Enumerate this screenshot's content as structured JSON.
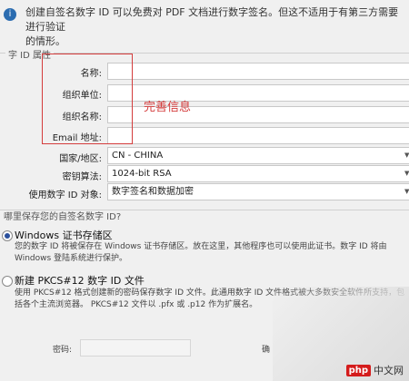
{
  "intro": {
    "icon": "info-icon",
    "line1": "创建自签名数字 ID 可以免费对 PDF 文档进行数字签名。但这不适用于有第三方需要进行验证",
    "line2": "的情形。"
  },
  "group": {
    "label": "字 ID 属性",
    "fields": {
      "name": {
        "label": "名称:",
        "value": ""
      },
      "org_unit": {
        "label": "组织单位:",
        "value": ""
      },
      "org_name": {
        "label": "组织名称:",
        "value": ""
      },
      "email": {
        "label": "Email 地址:",
        "value": ""
      }
    },
    "country": {
      "label": "国家/地区:",
      "value": "CN - CHINA"
    },
    "key_algorithm": {
      "label": "密钥算法:",
      "value": "1024-bit RSA"
    },
    "use_for": {
      "label": "使用数字 ID 对象:",
      "value": "数字签名和数据加密"
    }
  },
  "annotation": "完善信息",
  "storage": {
    "question": "哪里保存您的自签名数字 ID?",
    "windows": {
      "title": "Windows 证书存储区",
      "desc1": "您的数字 ID 将被保存在 Windows 证书存储区。放在这里，其他程序也可以使用此证书。数字 ID 将由",
      "desc2": "Windows 登陆系统进行保护。",
      "selected": true
    },
    "pkcs": {
      "title": "新建 PKCS#12 数字 ID 文件",
      "desc1": "使用 PKCS#12 格式创建新的密码保存数字 ID 文件。此通用数字 ID 文件格式被大多数安全软件所支持，包",
      "desc2": "括各个主流浏览器。 PKCS#12 文件以 .pfx 或 .p12 作为扩展名。",
      "selected": false
    },
    "password_label": "密码:",
    "confirm_label_partial": "确"
  },
  "watermark": {
    "badge": "php",
    "text": "中文网"
  }
}
